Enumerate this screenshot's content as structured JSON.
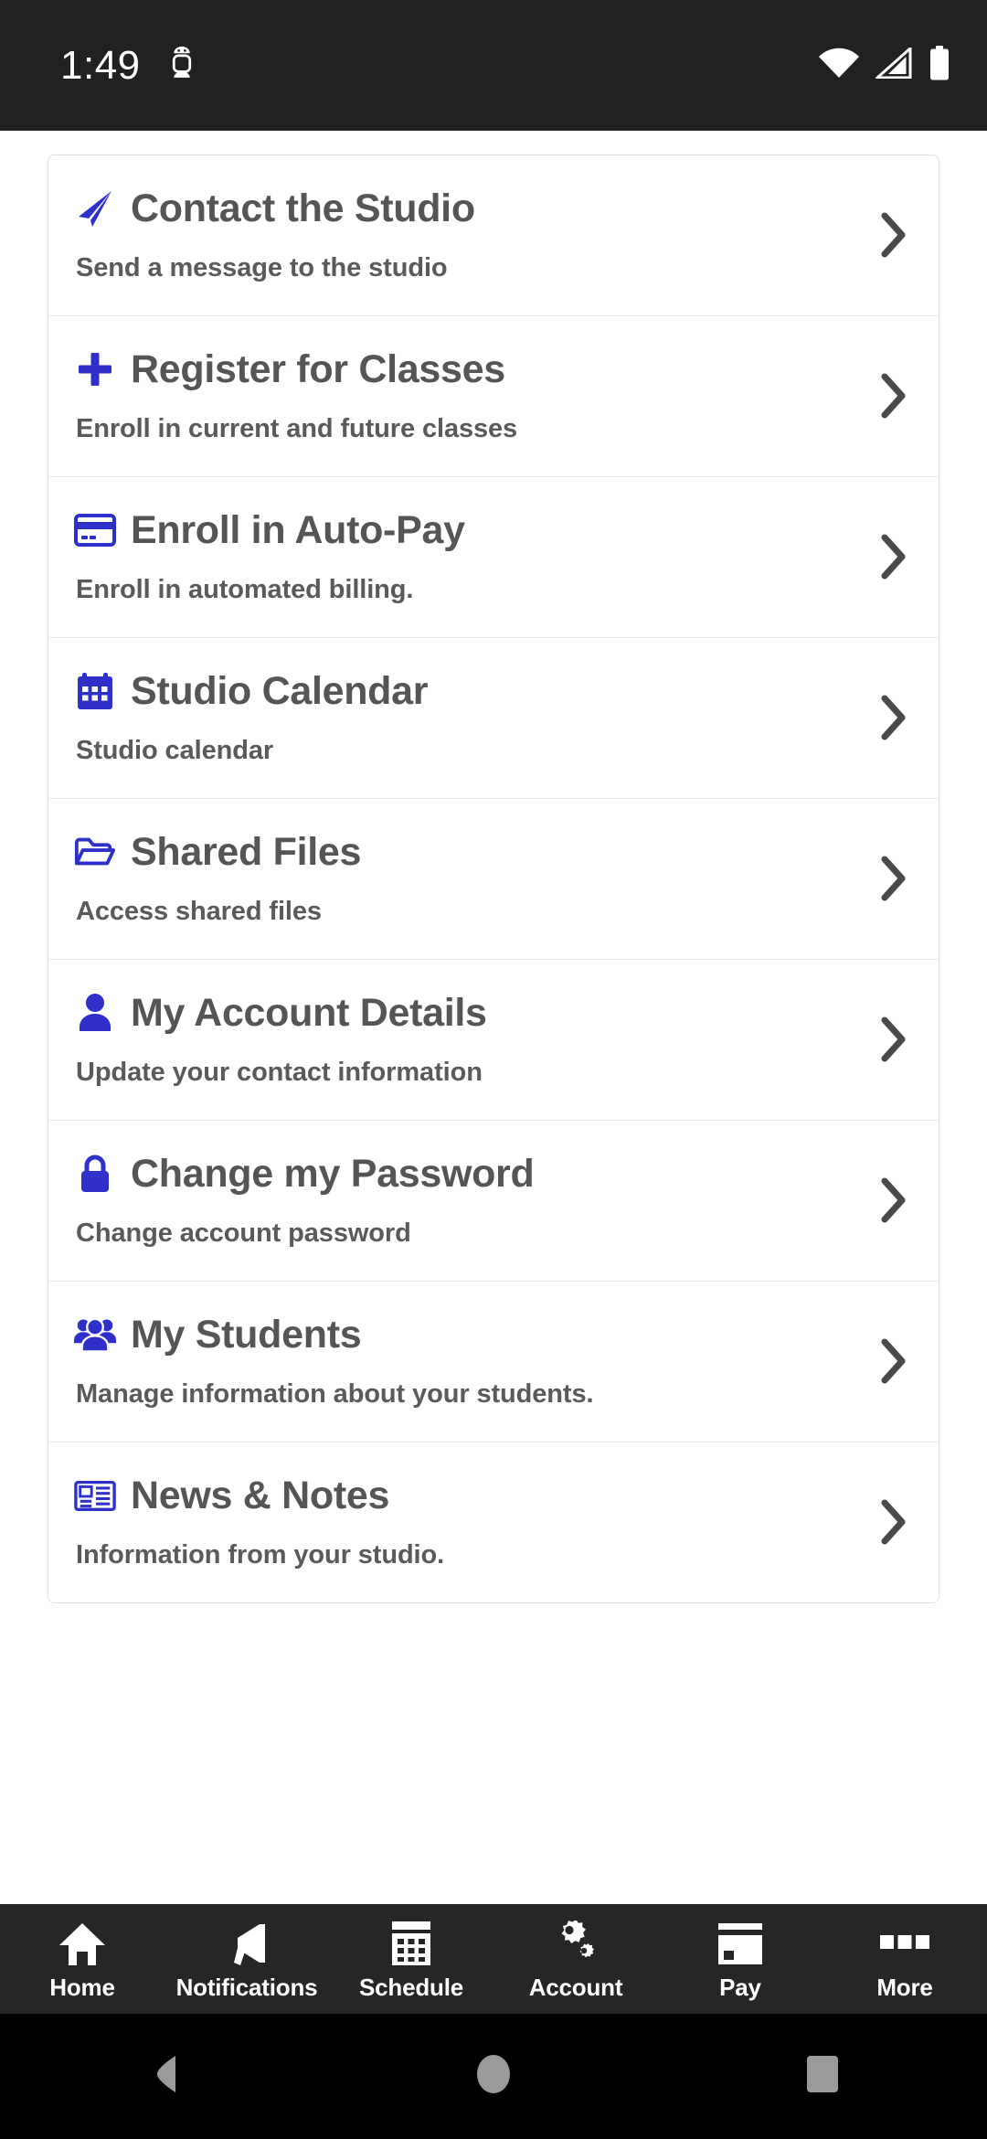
{
  "status_bar": {
    "time": "1:49",
    "left_icons": [
      "android-debug-icon"
    ],
    "right_icons": [
      "wifi-icon",
      "cell-signal-icon",
      "battery-icon"
    ],
    "background": "#212121",
    "foreground": "#ffffff"
  },
  "theme": {
    "accent": "#2f2fc9",
    "title_color": "#555558",
    "subtitle_color": "#5a5a5d",
    "card_border": "#e0e0e0",
    "tabbar_background": "#262626"
  },
  "menu": {
    "items": [
      {
        "icon": "paper-plane-icon",
        "title": "Contact the Studio",
        "subtitle": "Send a message to the studio",
        "chevron": "chevron-right-icon"
      },
      {
        "icon": "plus-icon",
        "title": "Register for Classes",
        "subtitle": "Enroll in current and future classes",
        "chevron": "chevron-right-icon"
      },
      {
        "icon": "credit-card-icon",
        "title": "Enroll in Auto-Pay",
        "subtitle": "Enroll in automated billing.",
        "chevron": "chevron-right-icon"
      },
      {
        "icon": "calendar-icon",
        "title": "Studio Calendar",
        "subtitle": "Studio calendar",
        "chevron": "chevron-right-icon"
      },
      {
        "icon": "folder-open-icon",
        "title": "Shared Files",
        "subtitle": "Access shared files",
        "chevron": "chevron-right-icon"
      },
      {
        "icon": "user-icon",
        "title": "My Account Details",
        "subtitle": "Update your contact information",
        "chevron": "chevron-right-icon"
      },
      {
        "icon": "lock-icon",
        "title": "Change my Password",
        "subtitle": "Change account password",
        "chevron": "chevron-right-icon"
      },
      {
        "icon": "users-group-icon",
        "title": "My Students",
        "subtitle": "Manage information about your students.",
        "chevron": "chevron-right-icon"
      },
      {
        "icon": "newspaper-icon",
        "title": "News & Notes",
        "subtitle": "Information from your studio.",
        "chevron": "chevron-right-icon"
      }
    ]
  },
  "tab_bar": {
    "tabs": [
      {
        "icon": "home-icon",
        "label": "Home"
      },
      {
        "icon": "megaphone-icon",
        "label": "Notifications"
      },
      {
        "icon": "calendar-grid-icon",
        "label": "Schedule"
      },
      {
        "icon": "gears-icon",
        "label": "Account"
      },
      {
        "icon": "credit-card-icon",
        "label": "Pay"
      },
      {
        "icon": "more-dots-icon",
        "label": "More"
      }
    ]
  },
  "nav_bar": {
    "buttons": [
      "back-triangle-icon",
      "home-circle-icon",
      "recents-square-icon"
    ]
  }
}
